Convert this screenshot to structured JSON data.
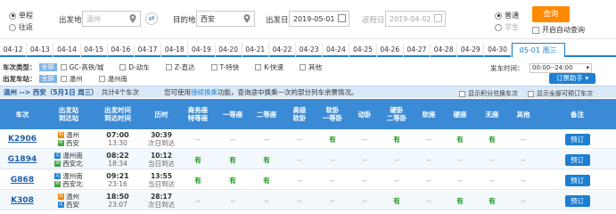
{
  "search": {
    "trip_type": [
      {
        "label": "单程",
        "selected": true
      },
      {
        "label": "往返",
        "selected": false
      }
    ],
    "from_label": "出发地",
    "from_value": "温州",
    "to_label": "目的地",
    "to_value": "西安",
    "depart_label": "出发日",
    "depart_value": "2019-05-01",
    "return_label": "返程日",
    "return_value": "2019-04-02",
    "passenger_type": [
      {
        "label": "普通",
        "selected": true
      },
      {
        "label": "学生",
        "selected": false
      }
    ],
    "query_label": "查询",
    "open_auto_query": "开启自动查询"
  },
  "dates": [
    {
      "label": "04-12"
    },
    {
      "label": "04-13"
    },
    {
      "label": "04-14"
    },
    {
      "label": "04-15"
    },
    {
      "label": "04-16"
    },
    {
      "label": "04-17"
    },
    {
      "label": "04-18"
    },
    {
      "label": "04-19"
    },
    {
      "label": "04-20"
    },
    {
      "label": "04-21"
    },
    {
      "label": "04-22"
    },
    {
      "label": "04-23"
    },
    {
      "label": "04-24"
    },
    {
      "label": "04-25"
    },
    {
      "label": "04-26"
    },
    {
      "label": "04-27"
    },
    {
      "label": "04-28"
    },
    {
      "label": "04-29"
    },
    {
      "label": "04-30"
    },
    {
      "label": "05-01 周三",
      "active": true
    }
  ],
  "filters": {
    "type_label": "车次类型：",
    "type_all": "全部",
    "types": [
      "GC-高铁/城",
      "D-动车",
      "Z-直达",
      "T-特快",
      "K-快速",
      "其他"
    ],
    "station_label": "出发车站：",
    "station_all": "全部",
    "stations": [
      "温州",
      "温州南"
    ],
    "depart_time_label": "发车时间：",
    "depart_time_value": "00:00--24:00",
    "agent_button": "订票助手"
  },
  "summary": {
    "route": "温州 --> 西安（5月1日 周三）",
    "count": "共计4个车次",
    "hint_prefix": "您可使用",
    "hint_link": "接续换乘",
    "hint_suffix": "功能，查询途中换乘一次的部分列车余票情况。",
    "opt1": "显示积分兑换车次",
    "opt2": "显示全部可预订车次"
  },
  "columns": {
    "train": "车次",
    "station": "出发站\n到达站",
    "time": "出发时间\n到达时间",
    "duration": "历时",
    "business": "商务座\n特等座",
    "first": "一等座",
    "second": "二等座",
    "adv_soft": "高级\n软卧",
    "soft_sleeper": "软卧\n一等卧",
    "moving_sleeper": "动卧",
    "hard_sleeper": "硬卧\n二等卧",
    "soft_seat": "软座",
    "hard_seat": "硬座",
    "no_seat": "无座",
    "other": "其他",
    "remark": "备注"
  },
  "trains": [
    {
      "code": "K2906",
      "from": "温州",
      "to": "西安",
      "from_type": "始",
      "to_type": "终",
      "dep": "07:00",
      "arr": "13:30",
      "dur": "30:39",
      "arrive_note": "次日到达",
      "business": "--",
      "first": "--",
      "second": "--",
      "adv_soft": "--",
      "soft_sleeper": "有",
      "moving_sleeper": "--",
      "hard_sleeper": "有",
      "soft_seat": "--",
      "hard_seat": "有",
      "no_seat": "有",
      "other": "--",
      "book": "预订"
    },
    {
      "code": "G1894",
      "from": "温州南",
      "to": "西安北",
      "from_type": "过",
      "to_type": "终",
      "dep": "08:22",
      "arr": "18:34",
      "dur": "10:12",
      "arrive_note": "当日到达",
      "business": "有",
      "first": "有",
      "second": "有",
      "adv_soft": "--",
      "soft_sleeper": "--",
      "moving_sleeper": "--",
      "hard_sleeper": "--",
      "soft_seat": "--",
      "hard_seat": "--",
      "no_seat": "--",
      "other": "--",
      "book": "预订"
    },
    {
      "code": "G868",
      "from": "温州南",
      "to": "西安北",
      "from_type": "过",
      "to_type": "终",
      "dep": "09:21",
      "arr": "23:16",
      "dur": "13:55",
      "arrive_note": "当日到达",
      "business": "有",
      "first": "有",
      "second": "有",
      "adv_soft": "--",
      "soft_sleeper": "--",
      "moving_sleeper": "--",
      "hard_sleeper": "--",
      "soft_seat": "--",
      "hard_seat": "--",
      "no_seat": "--",
      "other": "--",
      "book": "预订"
    },
    {
      "code": "K308",
      "from": "温州",
      "to": "西安",
      "from_type": "始",
      "to_type": "过",
      "dep": "18:50",
      "arr": "23:07",
      "dur": "28:17",
      "arrive_note": "次日到达",
      "business": "--",
      "first": "--",
      "second": "--",
      "adv_soft": "--",
      "soft_sleeper": "--",
      "moving_sleeper": "--",
      "hard_sleeper": "有",
      "soft_seat": "--",
      "hard_seat": "有",
      "no_seat": "有",
      "other": "--",
      "book": "预订"
    }
  ],
  "colors": {
    "accent": "#1e7fd0",
    "header": "#3a8ad6",
    "orange": "#ff8a00",
    "available": "#1a9a1a"
  }
}
